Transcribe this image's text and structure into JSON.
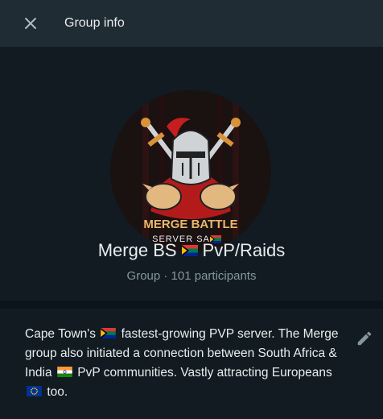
{
  "header": {
    "title": "Group info",
    "close_icon": "close-icon"
  },
  "group": {
    "name_part1": "Merge BS",
    "name_part2": "PvP/Raids",
    "meta": "Group · 101 participants",
    "avatar_text_line1": "MERGE BATTLE",
    "avatar_text_line2": "SERVER SA"
  },
  "description": {
    "part1": "Cape Town's",
    "part2": "fastest-growing PVP server. The Merge group also initiated a connection between South Africa & India",
    "part3": "PvP communities. Vastly attracting Europeans",
    "part4": "too.",
    "edit_icon": "pencil-icon"
  },
  "colors": {
    "header_bg": "#202c33",
    "panel_bg": "#111b21",
    "divider_bg": "#0b141a",
    "secondary_text": "#8696a0"
  }
}
